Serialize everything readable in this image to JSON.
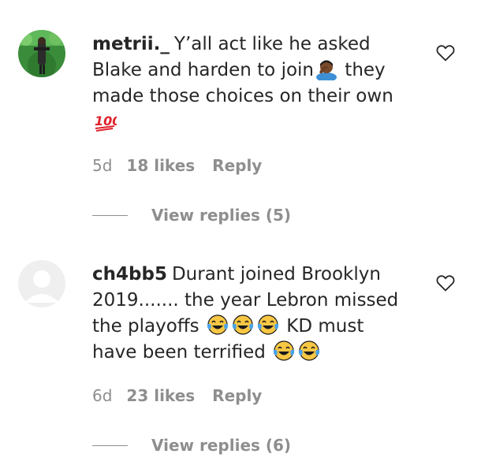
{
  "comments": [
    {
      "username": "metrii._",
      "text_parts": [
        "Y’all act like he asked Blake and harden to join",
        " they made those choices on their own",
        ""
      ],
      "emojis": [
        "person-facepalming-emoji",
        "hundred-points-emoji"
      ],
      "time": "5d",
      "likes": "18 likes",
      "reply_label": "Reply",
      "view_replies": "View replies (5)"
    },
    {
      "username": "ch4bb5",
      "text_parts": [
        "Durant joined Brooklyn 2019....... the year Lebron missed the playoffs",
        "KD must have been terrified"
      ],
      "emojis": [
        "tears-of-joy-emoji"
      ],
      "time": "6d",
      "likes": "23 likes",
      "reply_label": "Reply",
      "view_replies": "View replies (6)"
    }
  ],
  "colors": {
    "text": "#262626",
    "secondary": "#8e8e8e",
    "emoji_yellow": "#f7c744",
    "emoji_tear": "#4aa3e8",
    "hundred_red": "#e0202a"
  }
}
